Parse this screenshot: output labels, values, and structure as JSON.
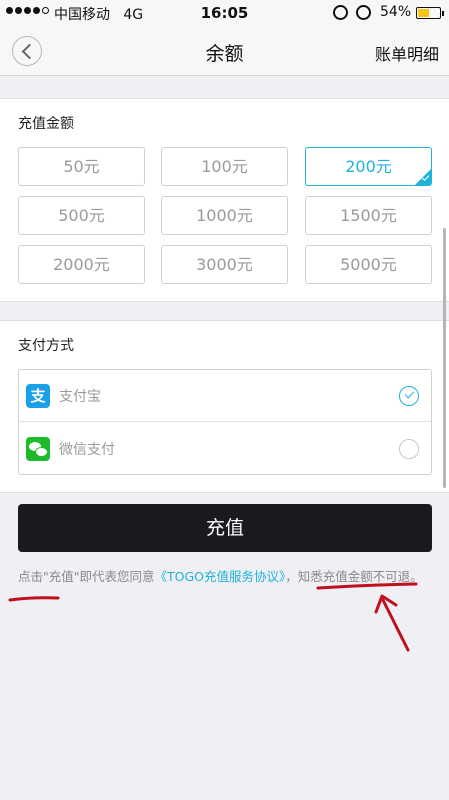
{
  "status_bar": {
    "carrier": "中国移动",
    "network": "4G",
    "time": "16:05",
    "battery_percent": "54%",
    "battery_level": 0.54
  },
  "nav": {
    "title": "余额",
    "right_link": "账单明细"
  },
  "amount_section": {
    "title": "充值金额",
    "options": [
      {
        "label": "50元",
        "selected": false
      },
      {
        "label": "100元",
        "selected": false
      },
      {
        "label": "200元",
        "selected": true
      },
      {
        "label": "500元",
        "selected": false
      },
      {
        "label": "1000元",
        "selected": false
      },
      {
        "label": "1500元",
        "selected": false
      },
      {
        "label": "2000元",
        "selected": false
      },
      {
        "label": "3000元",
        "selected": false
      },
      {
        "label": "5000元",
        "selected": false
      }
    ]
  },
  "payment_section": {
    "title": "支付方式",
    "methods": [
      {
        "label": "支付宝",
        "icon": "alipay-icon",
        "icon_text": "支",
        "selected": true
      },
      {
        "label": "微信支付",
        "icon": "wechat-icon",
        "selected": false
      }
    ]
  },
  "recharge_button": "充值",
  "agreement": {
    "prefix": "点击\"充值\"即代表您同意",
    "link": "《TOGO充值服务协议》",
    "suffix": "，知悉充值金额不可退。"
  },
  "colors": {
    "accent": "#1fb3d9",
    "button_bg": "#1a1a1f",
    "annotation": "#c0101e"
  }
}
